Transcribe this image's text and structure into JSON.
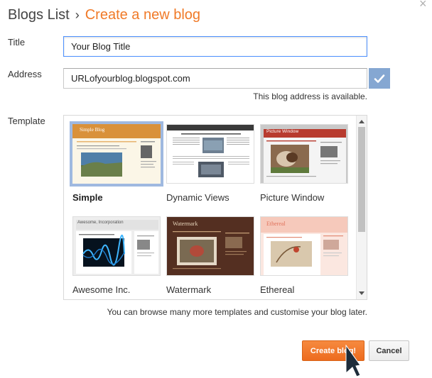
{
  "header": {
    "root": "Blogs List",
    "separator": "›",
    "current": "Create a new blog"
  },
  "close_glyph": "×",
  "form": {
    "title_label": "Title",
    "title_value": "Your Blog Title",
    "address_label": "Address",
    "address_value": "URLofyourblog.blogspot.com",
    "availability": "This blog address is available.",
    "template_label": "Template"
  },
  "templates": [
    {
      "name": "Simple",
      "selected": true,
      "thumb_title": "Simple Blog"
    },
    {
      "name": "Dynamic Views",
      "selected": false
    },
    {
      "name": "Picture Window",
      "selected": false,
      "thumb_title": "Picture Window"
    },
    {
      "name": "Awesome Inc.",
      "selected": false,
      "thumb_title": "Awesome, Incorporation"
    },
    {
      "name": "Watermark",
      "selected": false,
      "thumb_title": "Watermark"
    },
    {
      "name": "Ethereal",
      "selected": false,
      "thumb_title": "Ethereal"
    }
  ],
  "browse_note": "You can browse many more templates and customise your blog later.",
  "buttons": {
    "create": "Create blog!",
    "cancel": "Cancel"
  },
  "colors": {
    "accent": "#f07a28",
    "check_bg": "#85a7d2",
    "selected_border": "#9fb9e0"
  },
  "icons": {
    "close": "close-icon",
    "check": "check-icon",
    "cursor": "mouse-pointer-icon"
  }
}
